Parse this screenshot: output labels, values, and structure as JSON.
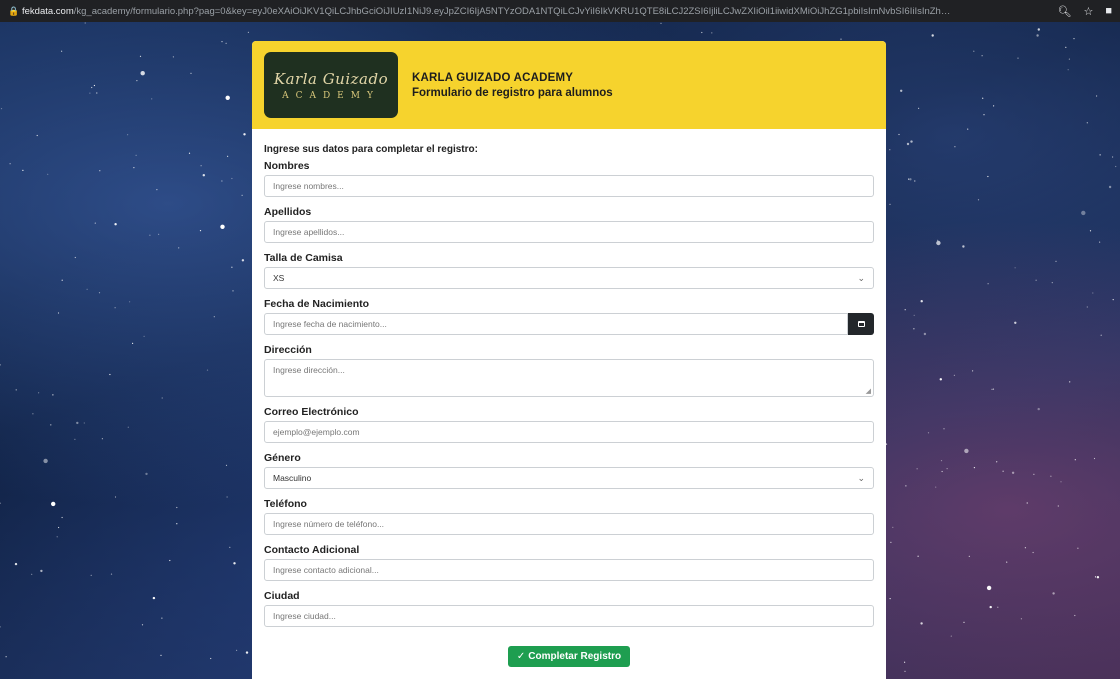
{
  "browser": {
    "host": "fekdata.com",
    "path": "/kg_academy/formulario.php?pag=0&key=eyJ0eXAiOiJKV1QiLCJhbGciOiJIUzI1NiJ9.eyJpZCI6IjA5NTYzODA1NTQiLCJvYiI6IkVKRU1QTE8iLCJ2ZSI6IjliLCJwZXIiOil1iiwidXMiOiJhZG1pbiIsImNvbSI6IiIsInZhbCI6IiIsImMtcF6ImRhdCI6MTY4OD…",
    "zoom_icon": "search-icon",
    "star_icon": "star-icon",
    "sidebar_icon": "side-panel-icon"
  },
  "header": {
    "logo_script": "Karla Guizado",
    "logo_sub": "ACADEMY",
    "title": "KARLA GUIZADO ACADEMY",
    "subtitle": "Formulario de registro para alumnos",
    "background": "#f6d32d"
  },
  "form": {
    "intro": "Ingrese sus datos para completar el registro:",
    "nombres": {
      "label": "Nombres",
      "placeholder": "Ingrese nombres..."
    },
    "apellidos": {
      "label": "Apellidos",
      "placeholder": "Ingrese apellidos..."
    },
    "talla": {
      "label": "Talla de Camisa",
      "value": "XS"
    },
    "fecha": {
      "label": "Fecha de Nacimiento",
      "placeholder": "Ingrese fecha de nacimiento..."
    },
    "direccion": {
      "label": "Dirección",
      "placeholder": "Ingrese dirección..."
    },
    "correo": {
      "label": "Correo Electrónico",
      "placeholder": "ejemplo@ejemplo.com"
    },
    "genero": {
      "label": "Género",
      "value": "Masculino"
    },
    "telefono": {
      "label": "Teléfono",
      "placeholder": "Ingrese número de teléfono..."
    },
    "contacto": {
      "label": "Contacto Adicional",
      "placeholder": "Ingrese contacto adicional..."
    },
    "ciudad": {
      "label": "Ciudad",
      "placeholder": "Ingrese ciudad..."
    },
    "submit_label": "Completar Registro",
    "submit_color": "#1e9e50"
  }
}
